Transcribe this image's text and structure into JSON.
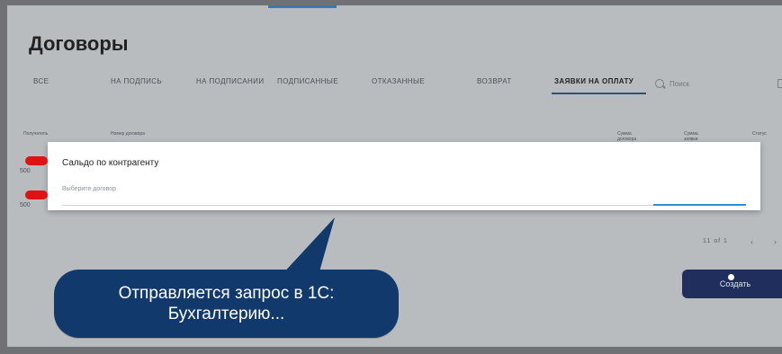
{
  "page": {
    "title": "Договоры"
  },
  "tabs": [
    {
      "label": "все"
    },
    {
      "label": "на подпись"
    },
    {
      "label": "на подписании"
    },
    {
      "label": "подписанные"
    },
    {
      "label": "отказанные"
    },
    {
      "label": "возврат"
    },
    {
      "label": "заявки на оплату",
      "active": true
    }
  ],
  "search": {
    "placeholder": "Поиск"
  },
  "table": {
    "headers": [
      "Получатель",
      "Номер договора",
      "Сумма договора",
      "Сумма заявки",
      "Статус"
    ],
    "rows": [
      "500",
      "500"
    ]
  },
  "pager": {
    "range": "11 of 1"
  },
  "create_button": {
    "label": "Создать"
  },
  "modal": {
    "title": "Сальдо по контрагенту",
    "field_label": "Выберите договор"
  },
  "callout": {
    "line1": "Отправляется запрос в 1С:",
    "line2": "Бухгалтерию..."
  },
  "colors": {
    "accent_blue": "#2e8fd0",
    "callout_bg": "#11396b",
    "button_bg": "#1f2e5d",
    "highlight_red": "#e01212"
  }
}
